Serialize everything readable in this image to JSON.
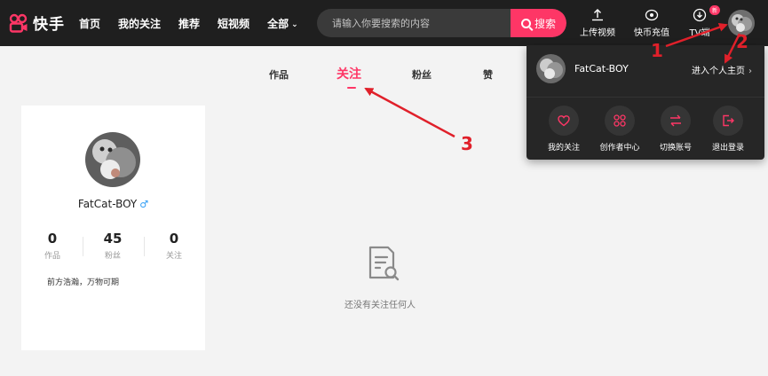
{
  "app": {
    "logo_text": "快手",
    "accent_color": "#fe3666"
  },
  "nav": {
    "items": [
      "首页",
      "我的关注",
      "推荐",
      "短视频"
    ],
    "all_label": "全部"
  },
  "search": {
    "placeholder": "请输入你要搜索的内容",
    "button_label": "搜索"
  },
  "tools": {
    "upload": "上传视频",
    "recharge": "快币充值",
    "tv": "TV端",
    "tv_badge": "新"
  },
  "tabs": [
    "作品",
    "关注",
    "粉丝",
    "赞"
  ],
  "active_tab": "关注",
  "profile": {
    "name": "FatCat-BOY",
    "gender_symbol": "♂",
    "stats": [
      {
        "value": "0",
        "label": "作品"
      },
      {
        "value": "45",
        "label": "粉丝"
      },
      {
        "value": "0",
        "label": "关注"
      }
    ],
    "bio": "前方浩瀚，万物可期"
  },
  "empty_state": {
    "text": "还没有关注任何人",
    "icon": "document-search-icon"
  },
  "dropdown": {
    "name": "FatCat-BOY",
    "homepage_link": "进入个人主页",
    "actions": [
      {
        "label": "我的关注",
        "icon": "heart-icon"
      },
      {
        "label": "创作者中心",
        "icon": "grid-icon"
      },
      {
        "label": "切换账号",
        "icon": "switch-icon"
      },
      {
        "label": "退出登录",
        "icon": "logout-icon"
      }
    ]
  },
  "annotations": {
    "labels": [
      "1",
      "2",
      "3"
    ],
    "color": "#e0202a"
  }
}
